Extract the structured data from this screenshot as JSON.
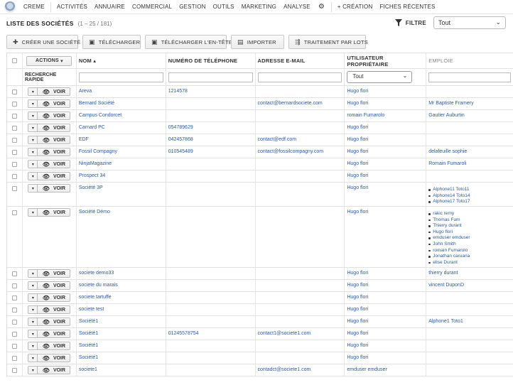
{
  "nav": {
    "items": [
      "CREME",
      "ACTIVITÉS",
      "ANNUAIRE",
      "COMMERCIAL",
      "GESTION",
      "OUTILS",
      "MARKETING",
      "ANALYSE"
    ],
    "creation": "+ CRÉATION",
    "recent": "FICHES RÉCENTES"
  },
  "header": {
    "title": "LISTE DES SOCIÉTÉS",
    "count": "(1 – 25 / 181)"
  },
  "filter": {
    "label": "FILTRE",
    "value": "Tout"
  },
  "toolbar": {
    "create": "CRÉER UNE SOCIÉTÉ",
    "download": "TÉLÉCHARGER",
    "download_header": "TÉLÉCHARGER L'EN-TÊTE",
    "import": "IMPORTER",
    "batch": "TRAITEMENT PAR LOTS"
  },
  "table": {
    "actions_label": "ACTIONS",
    "quick_search": "RECHERCHE RAPIDE",
    "columns": {
      "name": "NOM",
      "phone": "NUMÉRO DE TÉLÉPHONE",
      "email": "ADRESSE E-MAIL",
      "owner": "UTILISATEUR PROPRIÉTAIRE",
      "employee": "EMPLOIE"
    },
    "owner_filter": "Tout",
    "view_label": "VOIR",
    "rows": [
      {
        "name": "Areva",
        "phone": "1214578",
        "email": "",
        "owner": "Hugo flori",
        "employee": []
      },
      {
        "name": "Bernard Société",
        "phone": "",
        "email": "contact@bernardsociete.com",
        "owner": "Hugo flori",
        "employee": [
          "Mr Baptiste Framery"
        ]
      },
      {
        "name": "Campus Condorcet",
        "phone": "",
        "email": "",
        "owner": "romain Fumarolo",
        "employee": [
          "Gautier Auburtin"
        ]
      },
      {
        "name": "Carnard PC",
        "phone": "054789629",
        "email": "",
        "owner": "Hugo flori",
        "employee": []
      },
      {
        "name": "EDF",
        "phone": "042457868",
        "email": "contact@edf.com",
        "owner": "Hugo flori",
        "employee": []
      },
      {
        "name": "Fossil Compagny",
        "phone": "010545489",
        "email": "contact@fossilcompagny.com",
        "owner": "Hugo flori",
        "employee": [
          "delafeuille sophie"
        ]
      },
      {
        "name": "NinjaMagazine",
        "phone": "",
        "email": "",
        "owner": "Hugo flori",
        "employee": [
          "Romain Fumaroli"
        ]
      },
      {
        "name": "Prospect 34",
        "phone": "",
        "email": "",
        "owner": "Hugo flori",
        "employee": []
      },
      {
        "name": "Société 3P",
        "phone": "",
        "email": "",
        "owner": "Hugo flori",
        "list": [
          "Alphone11 Toto11",
          "Alphone14 Toto14",
          "Alphone17 Toto17"
        ]
      },
      {
        "name": "Société Démo",
        "phone": "",
        "email": "",
        "owner": "Hugo flori",
        "list": [
          "rakic remy",
          "Thomas Fum",
          "Thierry durant",
          "Hugo flori",
          "emduser emduser",
          "John Smith",
          "romain Fumarolo",
          "Jonathan caruana",
          "elise Durant"
        ]
      },
      {
        "name": "societe demo33",
        "phone": "",
        "email": "",
        "owner": "Hugo flori",
        "employee": [
          "thierry durant"
        ]
      },
      {
        "name": "societe du marais",
        "phone": "",
        "email": "",
        "owner": "Hugo flori",
        "employee": [
          "vincent DuponD"
        ]
      },
      {
        "name": "societe tartuffe",
        "phone": "",
        "email": "",
        "owner": "Hugo flori",
        "employee": []
      },
      {
        "name": "societe test",
        "phone": "",
        "email": "",
        "owner": "Hugo flori",
        "employee": []
      },
      {
        "name": "Société1",
        "phone": "",
        "email": "",
        "owner": "Hugo flori",
        "employee": [
          "Alphone1 Toto1"
        ]
      },
      {
        "name": "Société1",
        "phone": "01245578754",
        "email": "contact1@societe1.com",
        "owner": "Hugo flori",
        "employee": []
      },
      {
        "name": "Société1",
        "phone": "",
        "email": "",
        "owner": "Hugo flori",
        "employee": []
      },
      {
        "name": "Société1",
        "phone": "",
        "email": "",
        "owner": "Hugo flori",
        "employee": []
      },
      {
        "name": "societe1",
        "phone": "",
        "email": "contadct@societe1.com",
        "owner": "emduser emduser",
        "employee": []
      }
    ]
  }
}
